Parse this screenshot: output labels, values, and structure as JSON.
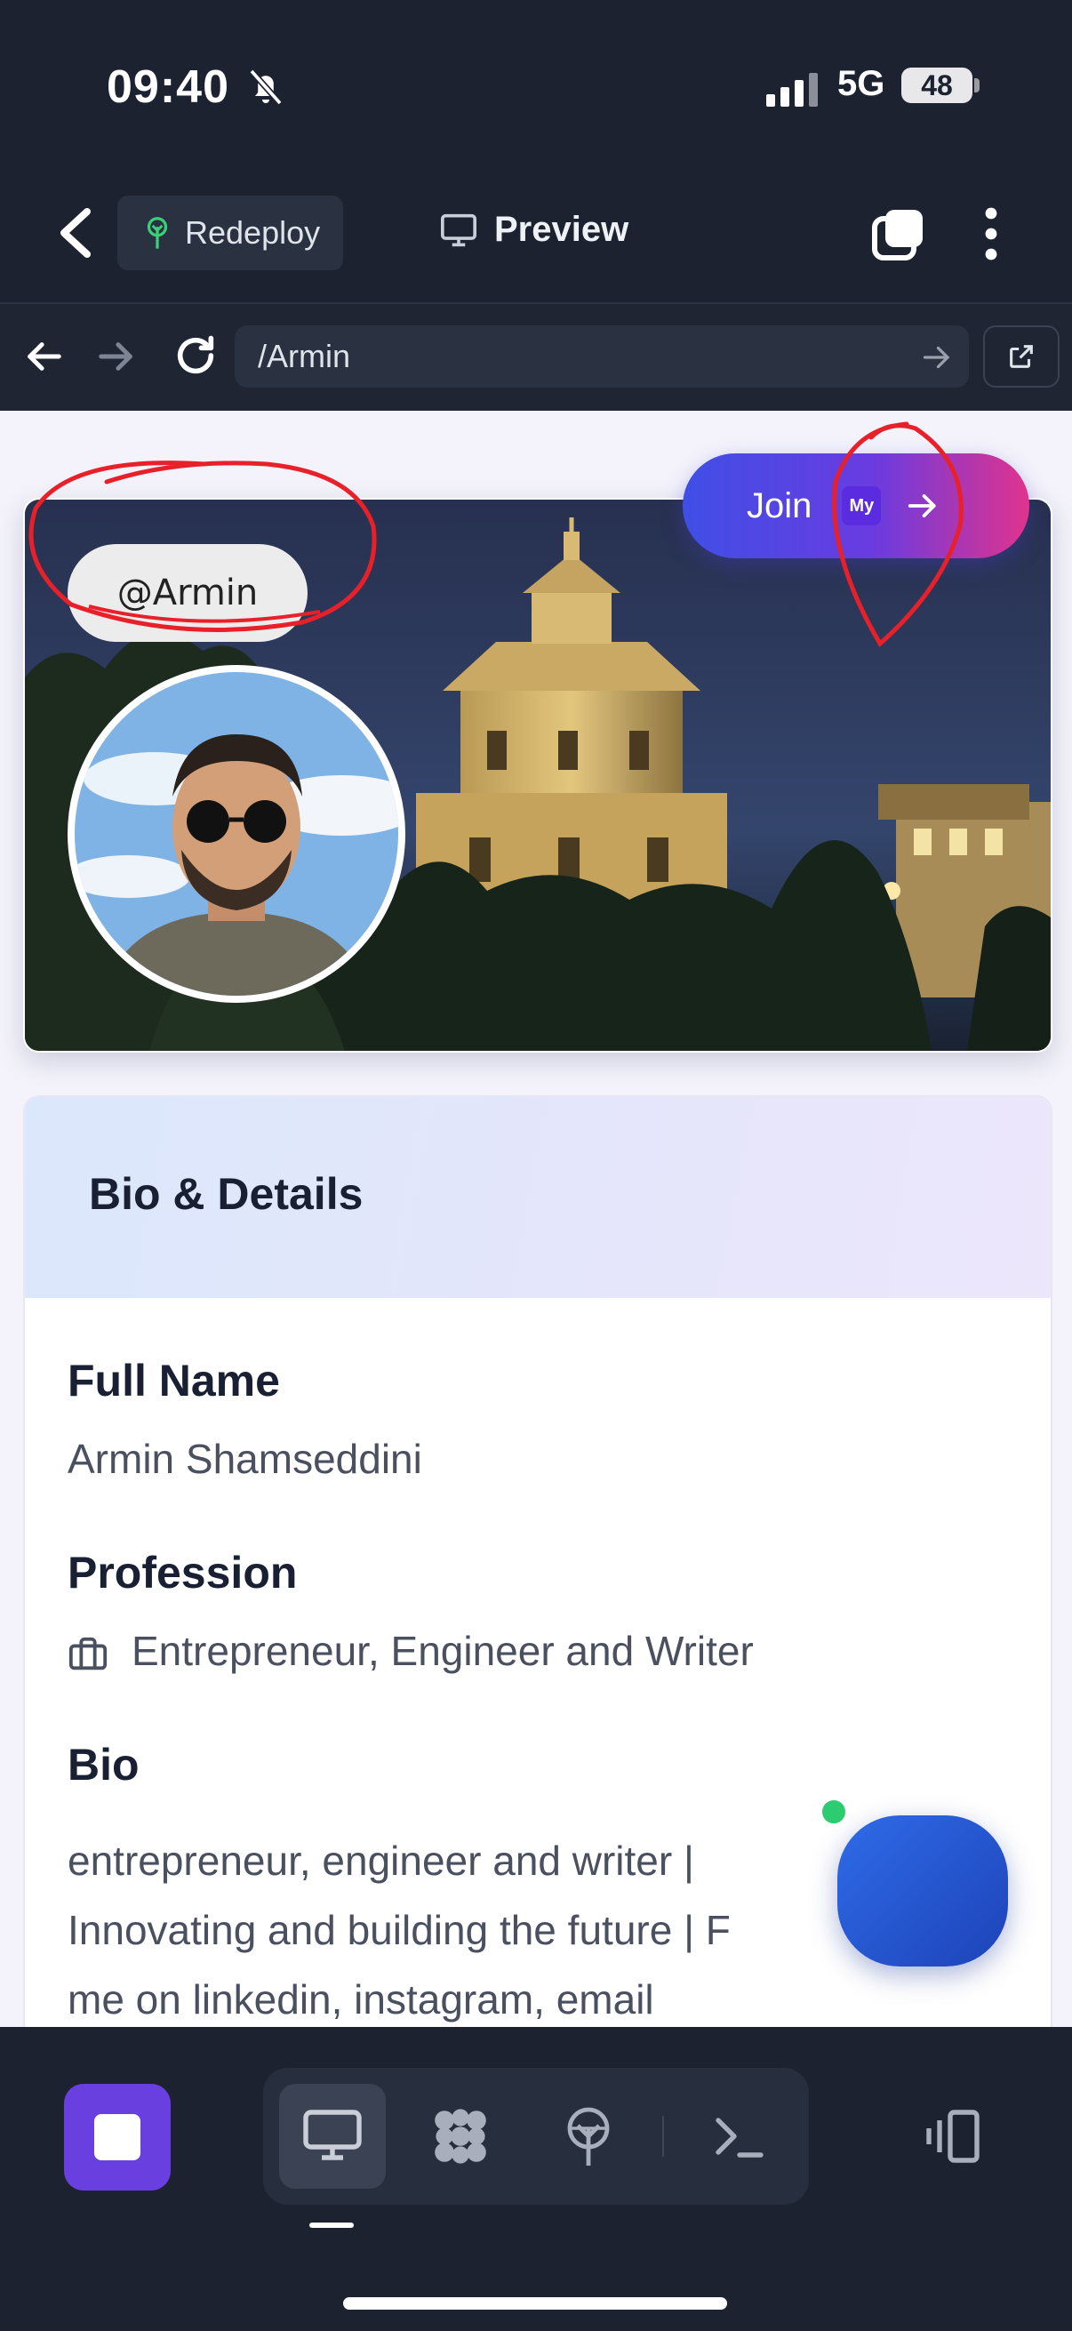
{
  "status_bar": {
    "time": "09:40",
    "network": "5G",
    "battery": "48"
  },
  "toolbar": {
    "redeploy_label": "Redeploy",
    "preview_label": "Preview"
  },
  "browser": {
    "url": "/Armin"
  },
  "profile": {
    "handle": "@Armin",
    "join_label": "Join",
    "join_badge": "My"
  },
  "details": {
    "title": "Bio & Details",
    "full_name_label": "Full Name",
    "full_name": "Armin Shamseddini",
    "profession_label": "Profession",
    "profession": "Entrepreneur, Engineer and Writer",
    "bio_label": "Bio",
    "bio_line1": "entrepreneur, engineer and writer |",
    "bio_line2": "Innovating and building the future | F",
    "bio_line3": "me on linkedin, instagram, email"
  },
  "colors": {
    "accent": "#6a3fe0",
    "join_start": "#3f4fe6",
    "join_end": "#e0338e",
    "annotation": "#e8202a"
  }
}
